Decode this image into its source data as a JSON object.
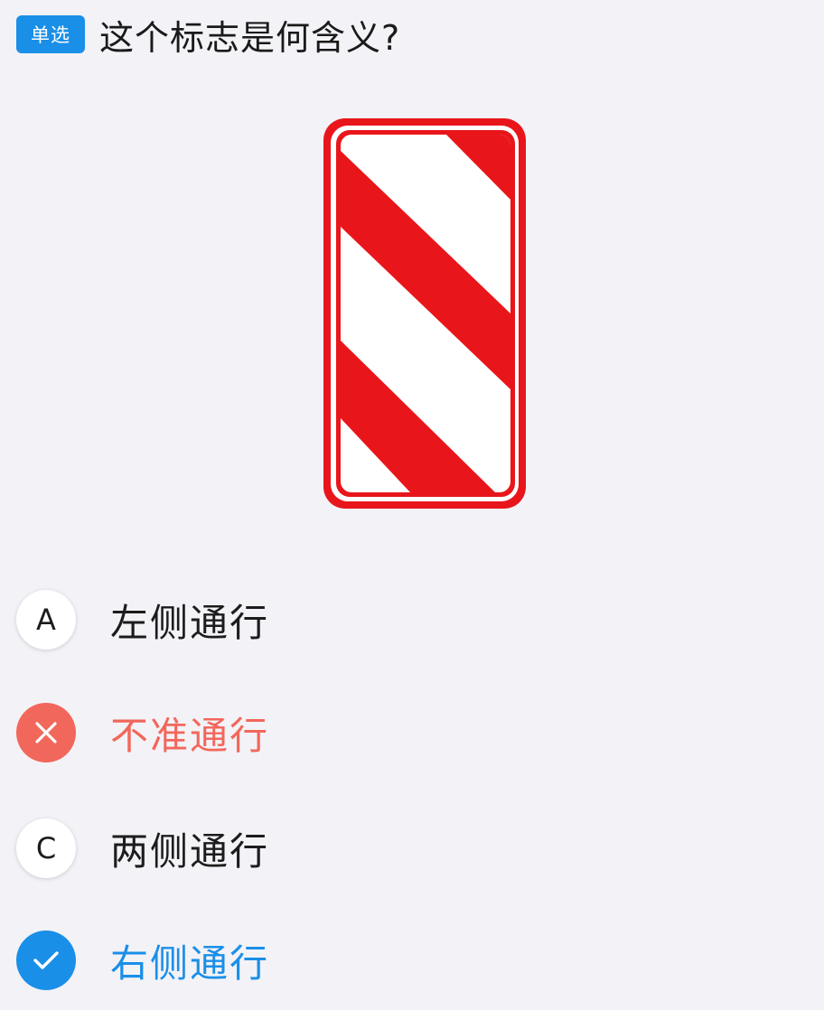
{
  "question": {
    "type_badge": "单选",
    "text": "这个标志是何含义?"
  },
  "sign": {
    "icon": "red-white-diagonal-stripe-sign",
    "colors": {
      "red": "#e8161b",
      "white": "#ffffff"
    }
  },
  "options": [
    {
      "letter": "A",
      "text": "左侧通行",
      "state": "normal"
    },
    {
      "letter": "",
      "text": "不准通行",
      "state": "wrong",
      "icon": "close-icon"
    },
    {
      "letter": "C",
      "text": "两侧通行",
      "state": "normal"
    },
    {
      "letter": "",
      "text": "右侧通行",
      "state": "correct",
      "icon": "check-icon"
    }
  ],
  "colors": {
    "accent_blue": "#1a8fe8",
    "wrong_red": "#f2675b",
    "background": "#f3f2f7"
  }
}
